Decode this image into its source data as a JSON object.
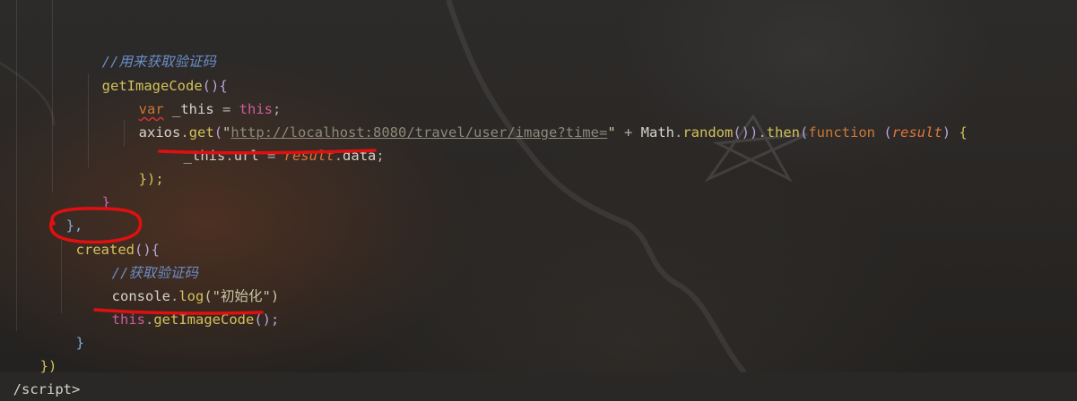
{
  "code": {
    "l1_comment": "//用来获取验证码",
    "l2_fn": "getImageCode",
    "l2_paren": "(){",
    "l3_var": "var",
    "l3_name": " _this ",
    "l3_eq": "= ",
    "l3_this": "this",
    "l3_semi": ";",
    "l4_axios": "axios",
    "l4_dot": ".",
    "l4_get": "get",
    "l4_open": "(",
    "l4_q1": "\"",
    "l4_url": "http://localhost:8080/travel/user/image?time=",
    "l4_q2": "\"",
    "l4_plus": " + ",
    "l4_math": "Math",
    "l4_dot2": ".",
    "l4_random": "random",
    "l4_parens": "())",
    "l4_dot3": ".",
    "l4_then": "then",
    "l4_open2": "(",
    "l4_function": "function",
    "l4_sp": " ",
    "l4_popen": "(",
    "l4_param": "result",
    "l4_pclose": ")",
    "l4_brace": " {",
    "l5_this": "_this",
    "l5_dot": ".",
    "l5_url": "url",
    "l5_eq": " = ",
    "l5_result": "result",
    "l5_dot2": ".",
    "l5_data": "data",
    "l5_semi": ";",
    "l6_close": "});",
    "l7_close": "}",
    "l8_close": "},",
    "l9_created": "created",
    "l9_paren": "(){",
    "l10_comment": "//获取验证码",
    "l11_console": "console",
    "l11_dot": ".",
    "l11_log": "log",
    "l11_arg": "(\"初始化\")",
    "l12_this": "this",
    "l12_dot": ".",
    "l12_call": "getImageCode",
    "l12_paren": "();",
    "l13_close": "}",
    "l14_close": "})",
    "l15_tag": "/script>"
  },
  "colors": {
    "annotation": "#e01010",
    "background": "#2a2826"
  }
}
